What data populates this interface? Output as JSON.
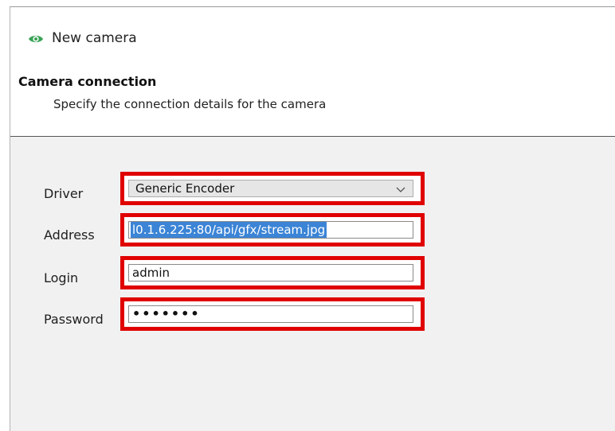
{
  "window": {
    "title": "New camera",
    "icon": "eye-icon",
    "icon_color": "#3aa357"
  },
  "header": {
    "title": "Camera connection",
    "subtitle": "Specify the connection details for the camera"
  },
  "form": {
    "driver": {
      "label": "Driver",
      "value": "Generic Encoder",
      "dropdown_icon": "chevron-down-icon"
    },
    "address": {
      "label": "Address",
      "value": "l0.1.6.225:80/api/gfx/stream.jpg",
      "selected": true
    },
    "login": {
      "label": "Login",
      "value": "admin"
    },
    "password": {
      "label": "Password",
      "masked_value": "•••••••"
    }
  },
  "highlight_color": "#e00000"
}
